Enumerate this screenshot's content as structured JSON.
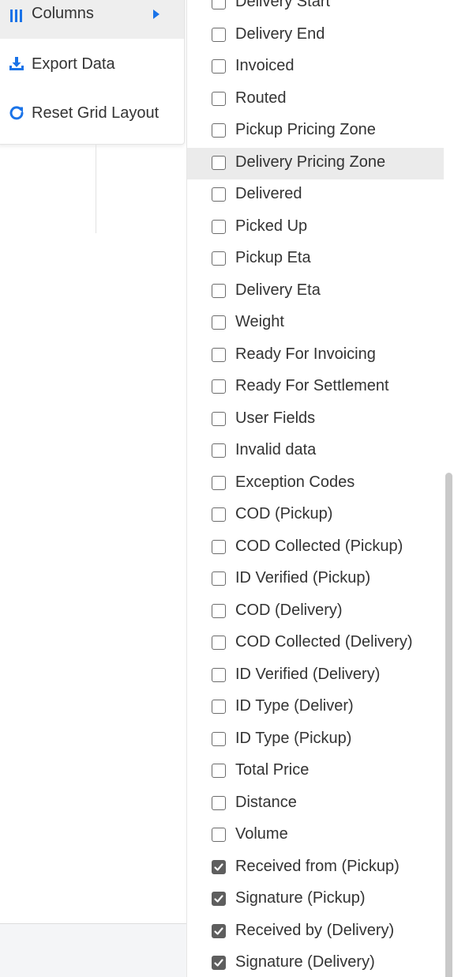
{
  "menu": {
    "columns_label": "Columns",
    "export_label": "Export Data",
    "reset_label": "Reset Grid Layout",
    "columns_icon": "columns-icon",
    "export_icon": "download-icon",
    "reset_icon": "refresh-icon",
    "accent_color": "#1a73e8"
  },
  "columns_panel": {
    "items": [
      {
        "label": "Delivery Start",
        "checked": false
      },
      {
        "label": "Delivery End",
        "checked": false
      },
      {
        "label": "Invoiced",
        "checked": false
      },
      {
        "label": "Routed",
        "checked": false
      },
      {
        "label": "Pickup Pricing Zone",
        "checked": false
      },
      {
        "label": "Delivery Pricing Zone",
        "checked": false
      },
      {
        "label": "Delivered",
        "checked": false
      },
      {
        "label": "Picked Up",
        "checked": false
      },
      {
        "label": "Pickup Eta",
        "checked": false
      },
      {
        "label": "Delivery Eta",
        "checked": false
      },
      {
        "label": "Weight",
        "checked": false
      },
      {
        "label": "Ready For Invoicing",
        "checked": false
      },
      {
        "label": "Ready For Settlement",
        "checked": false
      },
      {
        "label": "User Fields",
        "checked": false
      },
      {
        "label": "Invalid data",
        "checked": false
      },
      {
        "label": "Exception Codes",
        "checked": false
      },
      {
        "label": "COD (Pickup)",
        "checked": false
      },
      {
        "label": "COD Collected (Pickup)",
        "checked": false
      },
      {
        "label": "ID Verified (Pickup)",
        "checked": false
      },
      {
        "label": "COD (Delivery)",
        "checked": false
      },
      {
        "label": "COD Collected (Delivery)",
        "checked": false
      },
      {
        "label": "ID Verified (Delivery)",
        "checked": false
      },
      {
        "label": "ID Type (Deliver)",
        "checked": false
      },
      {
        "label": "ID Type (Pickup)",
        "checked": false
      },
      {
        "label": "Total Price",
        "checked": false
      },
      {
        "label": "Distance",
        "checked": false
      },
      {
        "label": "Volume",
        "checked": false
      },
      {
        "label": "Received from (Pickup)",
        "checked": true
      },
      {
        "label": "Signature (Pickup)",
        "checked": true
      },
      {
        "label": "Received by (Delivery)",
        "checked": true
      },
      {
        "label": "Signature (Delivery)",
        "checked": true
      }
    ]
  }
}
